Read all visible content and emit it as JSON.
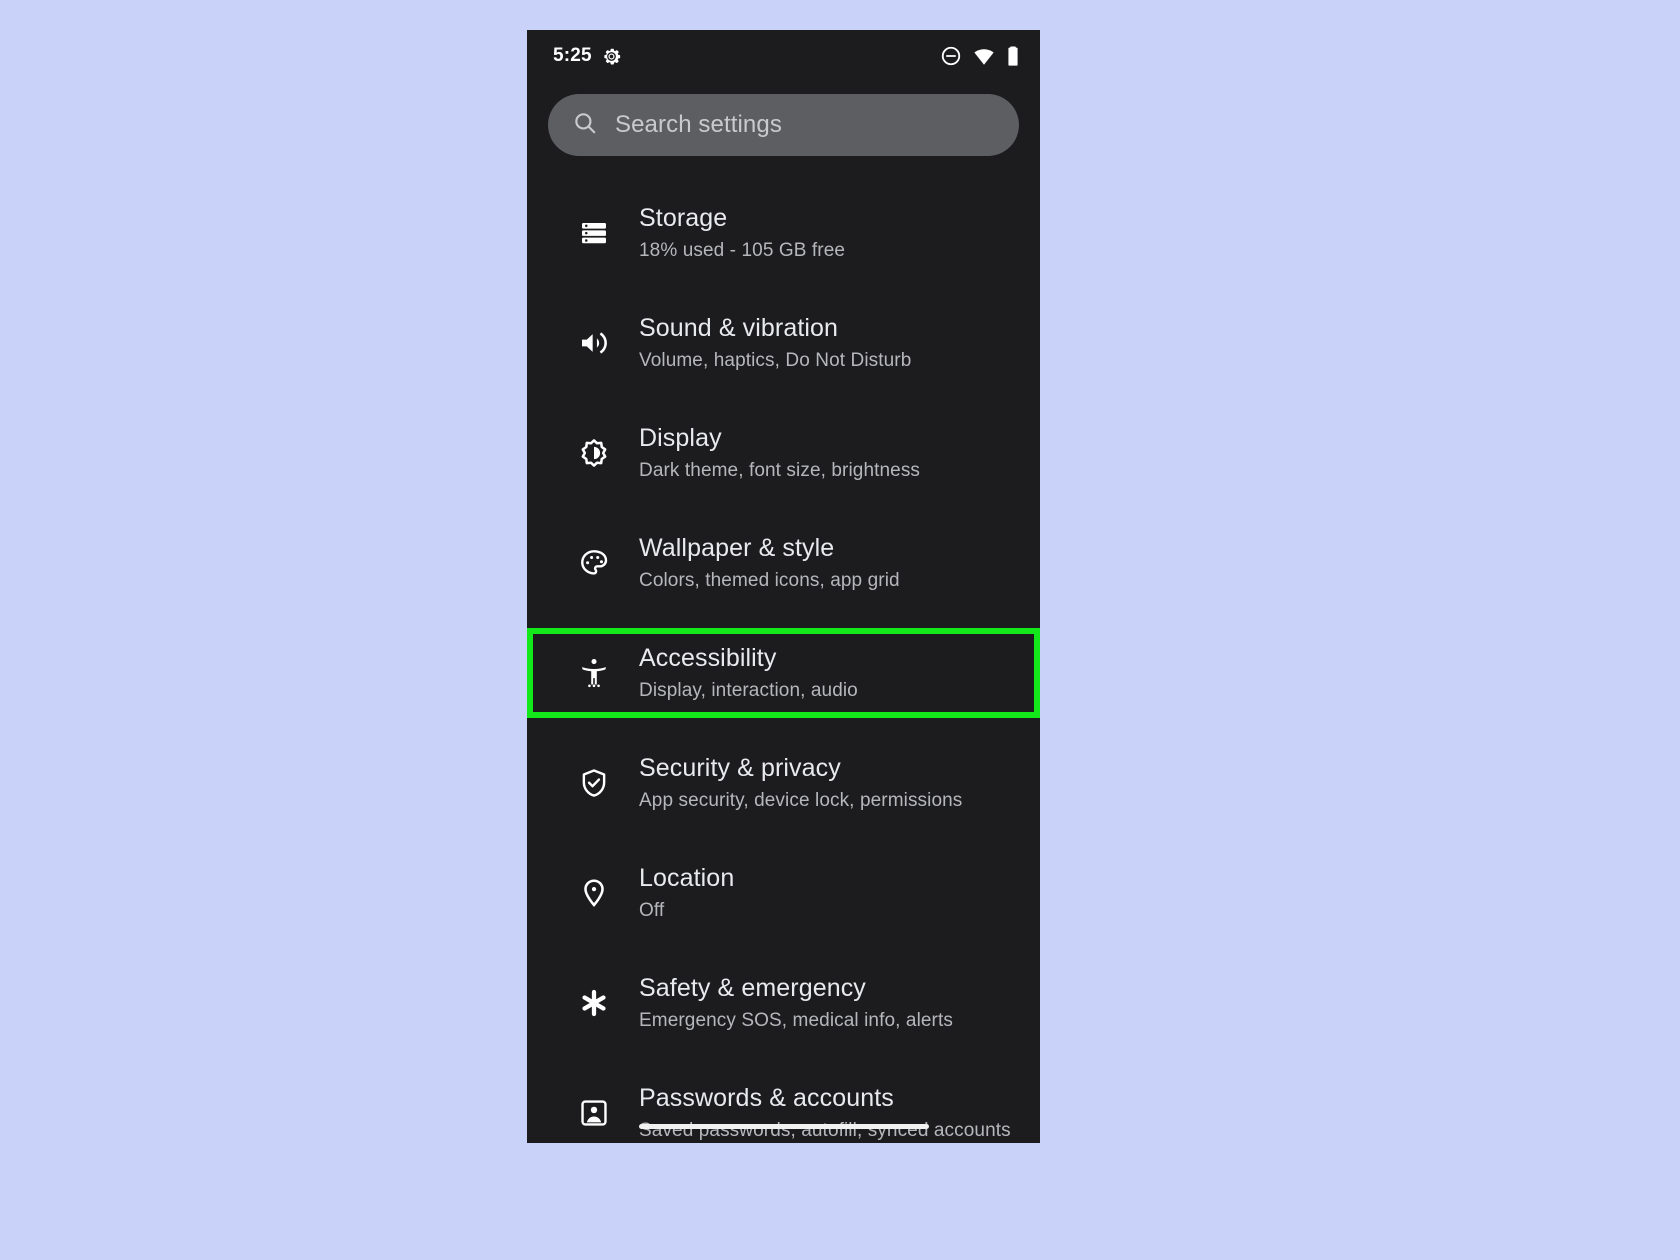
{
  "background_color": "#c9d3f9",
  "screen_background": "#1c1c1e",
  "highlight_color": "#12e81a",
  "statusbar": {
    "clock": "5:25",
    "settings_gear_icon": "gear-icon",
    "dnd_icon": "do-not-disturb-icon",
    "wifi_icon": "wifi-icon",
    "battery_icon": "battery-icon"
  },
  "search": {
    "placeholder": "Search settings",
    "icon": "search-icon"
  },
  "list": {
    "items": [
      {
        "icon": "storage-icon",
        "title": "Storage",
        "subtitle": "18% used - 105 GB free",
        "highlighted": false
      },
      {
        "icon": "volume-up-icon",
        "title": "Sound & vibration",
        "subtitle": "Volume, haptics, Do Not Disturb",
        "highlighted": false
      },
      {
        "icon": "brightness-icon",
        "title": "Display",
        "subtitle": "Dark theme, font size, brightness",
        "highlighted": false
      },
      {
        "icon": "palette-icon",
        "title": "Wallpaper & style",
        "subtitle": "Colors, themed icons, app grid",
        "highlighted": false
      },
      {
        "icon": "accessibility-icon",
        "title": "Accessibility",
        "subtitle": "Display, interaction, audio",
        "highlighted": true
      },
      {
        "icon": "shield-check-icon",
        "title": "Security & privacy",
        "subtitle": "App security, device lock, permissions",
        "highlighted": false
      },
      {
        "icon": "location-pin-icon",
        "title": "Location",
        "subtitle": "Off",
        "highlighted": false
      },
      {
        "icon": "asterisk-icon",
        "title": "Safety & emergency",
        "subtitle": "Emergency SOS, medical info, alerts",
        "highlighted": false
      },
      {
        "icon": "account-box-icon",
        "title": "Passwords & accounts",
        "subtitle": "Saved passwords, autofill, synced accounts",
        "highlighted": false
      }
    ]
  }
}
